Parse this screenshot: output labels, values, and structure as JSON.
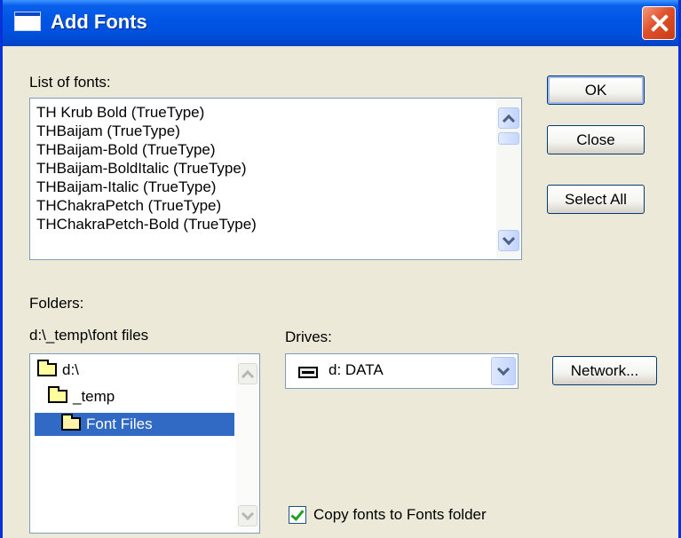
{
  "window": {
    "title": "Add Fonts",
    "icon": "window-icon",
    "close_icon": "close-icon"
  },
  "fonts": {
    "label": "List of fonts:",
    "items": [
      "TH Krub Bold (TrueType)",
      "THBaijam (TrueType)",
      "THBaijam-Bold (TrueType)",
      "THBaijam-BoldItalic (TrueType)",
      "THBaijam-Italic (TrueType)",
      "THChakraPetch (TrueType)",
      "THChakraPetch-Bold (TrueType)"
    ]
  },
  "buttons": {
    "ok": "OK",
    "close": "Close",
    "select_all": "Select All",
    "network": "Network..."
  },
  "folders": {
    "label": "Folders:",
    "current_path": "d:\\_temp\\font files",
    "items": [
      {
        "name": "d:\\",
        "icon": "folder-open-icon",
        "selected": false
      },
      {
        "name": "_temp",
        "icon": "folder-open-icon",
        "selected": false
      },
      {
        "name": "Font Files",
        "icon": "folder-open-icon",
        "selected": true
      }
    ]
  },
  "drives": {
    "label": "Drives:",
    "selected": "d: DATA",
    "icon": "drive-icon"
  },
  "copy_option": {
    "label": "Copy fonts to Fonts folder",
    "checked": true
  },
  "colors": {
    "titlebar": "#0054e3",
    "selection": "#316ac5",
    "dialog_bg": "#ece9d8",
    "close_button": "#e0502a"
  }
}
